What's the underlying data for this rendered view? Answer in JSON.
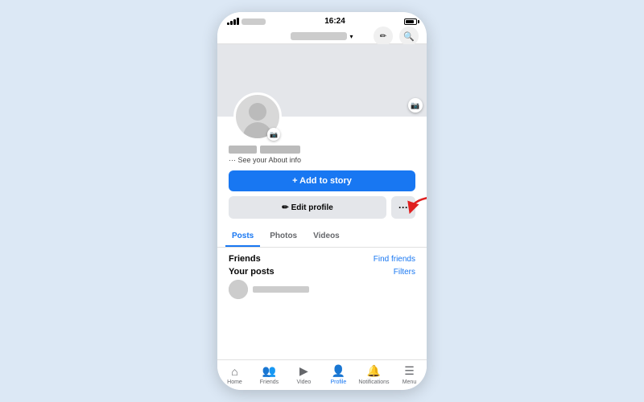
{
  "status_bar": {
    "time": "16:24"
  },
  "top_nav": {
    "edit_icon": "✏",
    "search_icon": "🔍"
  },
  "profile": {
    "about_text": "··· See your About info"
  },
  "buttons": {
    "add_story_label": "+ Add to story",
    "edit_profile_icon": "✏",
    "edit_profile_label": " Edit profile",
    "more_label": "···"
  },
  "tabs": [
    {
      "label": "Posts",
      "active": true
    },
    {
      "label": "Photos",
      "active": false
    },
    {
      "label": "Videos",
      "active": false
    }
  ],
  "sections": {
    "friends_title": "Friends",
    "friends_link": "Find friends",
    "posts_title": "Your posts",
    "posts_link": "Filters"
  },
  "bottom_nav": [
    {
      "label": "Home",
      "icon": "⌂",
      "active": false
    },
    {
      "label": "Friends",
      "icon": "👥",
      "active": false
    },
    {
      "label": "Video",
      "icon": "▶",
      "active": false
    },
    {
      "label": "Profile",
      "icon": "👤",
      "active": true
    },
    {
      "label": "Notifications",
      "icon": "🔔",
      "active": false
    },
    {
      "label": "Menu",
      "icon": "☰",
      "active": false
    }
  ],
  "colors": {
    "accent": "#1877f2",
    "bg": "#dce8f5"
  }
}
